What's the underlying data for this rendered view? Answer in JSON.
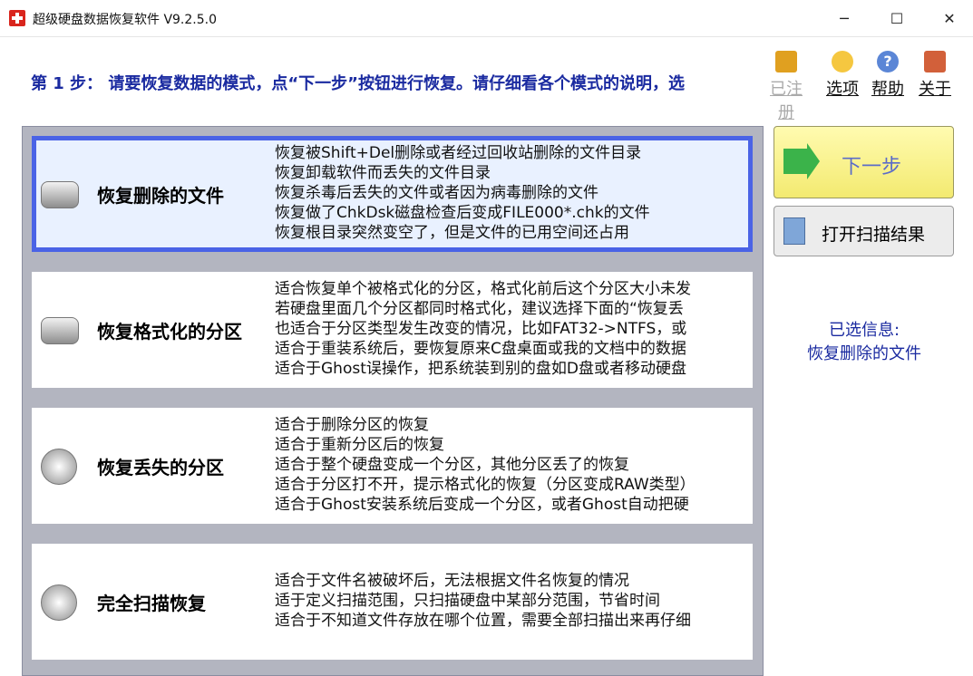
{
  "window": {
    "title": "超级硬盘数据恢复软件 V9.2.5.0"
  },
  "step": {
    "text": "第 1 步：  请要恢复数据的模式，点“下一步”按钮进行恢复。请仔细看各个模式的说明，选"
  },
  "toolbar": {
    "register": "已注册",
    "options": "选项",
    "help": "帮助",
    "about": "关于"
  },
  "modes": [
    {
      "title": "恢复删除的文件",
      "lines": [
        "恢复被Shift+Del删除或者经过回收站删除的文件目录",
        "恢复卸载软件而丢失的文件目录",
        "恢复杀毒后丢失的文件或者因为病毒删除的文件",
        "恢复做了ChkDsk磁盘检查后变成FILE000*.chk的文件",
        "恢复根目录突然变空了，但是文件的已用空间还占用"
      ]
    },
    {
      "title": "恢复格式化的分区",
      "lines": [
        "适合恢复单个被格式化的分区，格式化前后这个分区大小未发",
        "若硬盘里面几个分区都同时格式化，建议选择下面的“恢复丢",
        "也适合于分区类型发生改变的情况，比如FAT32->NTFS，或",
        "适合于重装系统后，要恢复原来C盘桌面或我的文档中的数据",
        "适合于Ghost误操作，把系统装到别的盘如D盘或者移动硬盘"
      ]
    },
    {
      "title": "恢复丢失的分区",
      "lines": [
        "适合于删除分区的恢复",
        "适合于重新分区后的恢复",
        "适合于整个硬盘变成一个分区，其他分区丢了的恢复",
        "适合于分区打不开，提示格式化的恢复（分区变成RAW类型）",
        "适合于Ghost安装系统后变成一个分区，或者Ghost自动把硬"
      ]
    },
    {
      "title": "完全扫描恢复",
      "lines": [
        "适合于文件名被破坏后，无法根据文件名恢复的情况",
        "适于定义扫描范围，只扫描硬盘中某部分范围，节省时间",
        "适合于不知道文件存放在哪个位置，需要全部扫描出来再仔细"
      ]
    }
  ],
  "buttons": {
    "next": "下一步",
    "open_scan": "打开扫描结果"
  },
  "selection": {
    "label": "已选信息:",
    "value": "恢复删除的文件"
  }
}
